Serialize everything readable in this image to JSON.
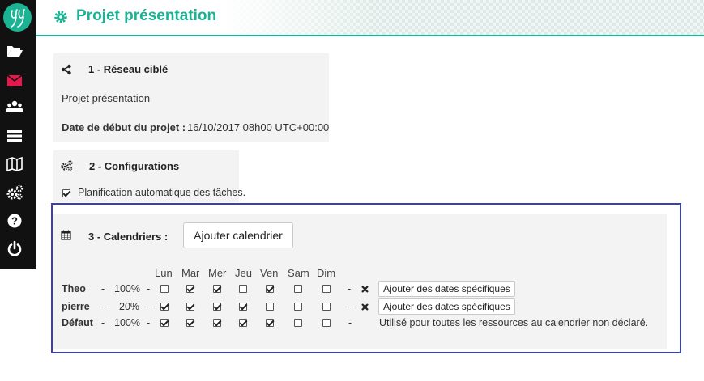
{
  "header": {
    "title": "Projet présentation"
  },
  "sidebar": {
    "items": [
      {
        "icon": "folder-open-icon"
      },
      {
        "icon": "envelope-icon",
        "color": "#e8174e"
      },
      {
        "icon": "users-icon"
      },
      {
        "icon": "list-icon"
      },
      {
        "icon": "map-icon"
      },
      {
        "icon": "cogs-icon"
      },
      {
        "icon": "question-icon"
      },
      {
        "icon": "power-icon"
      }
    ]
  },
  "section1": {
    "title": "1 - Réseau ciblé",
    "project_link": "Projet présentation",
    "start_label": "Date de début du projet :",
    "start_value": "16/10/2017 08h00 UTC+00:00"
  },
  "section2": {
    "title": "2 - Configurations",
    "auto_planning_label": "Planification automatique des tâches.",
    "auto_planning_checked": true
  },
  "section3": {
    "title": "3 - Calendriers :",
    "add_calendar_label": "Ajouter calendrier",
    "days": [
      "Lun",
      "Mar",
      "Mer",
      "Jeu",
      "Ven",
      "Sam",
      "Dim"
    ],
    "rows": [
      {
        "name": "Theo",
        "dash1": "-",
        "percent": "100%",
        "dash2": "-",
        "days": [
          false,
          true,
          true,
          false,
          true,
          false,
          false
        ],
        "dash3": "-",
        "action_label": "Ajouter des dates spécifiques"
      },
      {
        "name": "pierre",
        "dash1": "-",
        "percent": "20%",
        "dash2": "-",
        "days": [
          true,
          true,
          true,
          true,
          false,
          false,
          false
        ],
        "dash3": "-",
        "action_label": "Ajouter des dates spécifiques"
      },
      {
        "name": "Défaut",
        "dash1": "-",
        "percent": "100%",
        "dash2": "-",
        "days": [
          true,
          true,
          true,
          true,
          true,
          false,
          false
        ],
        "dash3": "-",
        "note": "Utilisé pour toutes les ressources au calendrier non déclaré."
      }
    ]
  },
  "colors": {
    "accent": "#1ab394",
    "sidebar": "#111111",
    "highlight": "#3a40b0"
  }
}
